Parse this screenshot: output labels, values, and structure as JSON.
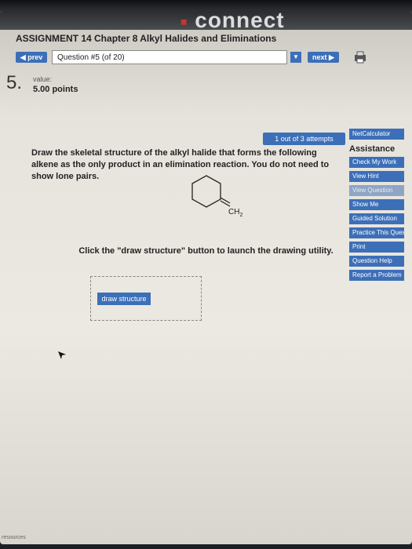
{
  "brand": {
    "name": "connect"
  },
  "assignment": {
    "title": "ASSIGNMENT 14 Chapter 8 Alkyl Halides and Eliminations"
  },
  "nav": {
    "prev_label": "◀ prev",
    "question_select": "Question #5 (of 20)",
    "next_label": "next ▶"
  },
  "question": {
    "number": "5.",
    "value_label": "value:",
    "points": "5.00 points",
    "attempts": "1 out of 3 attempts",
    "prompt": "Draw the skeletal structure of the alkyl halide that forms the following alkene as the only product in an elimination reaction. You do not need to show lone pairs.",
    "molecule_label": "CH",
    "molecule_subscript": "2",
    "instruction": "Click the \"draw structure\" button to launch the drawing utility.",
    "draw_button": "draw structure"
  },
  "sidebar": {
    "calculator": "NetCalculator",
    "assistance_heading": "Assistance",
    "buttons": [
      {
        "label": "Check My Work",
        "enabled": true
      },
      {
        "label": "View Hint",
        "enabled": true
      },
      {
        "label": "View Question",
        "enabled": false
      },
      {
        "label": "Show Me",
        "enabled": true
      },
      {
        "label": "Guided Solution",
        "enabled": true
      },
      {
        "label": "Practice This Question",
        "enabled": true
      },
      {
        "label": "Print",
        "enabled": true
      },
      {
        "label": "Question Help",
        "enabled": true
      },
      {
        "label": "Report a Problem",
        "enabled": true
      }
    ]
  },
  "footer": {
    "resources": "resources"
  },
  "colors": {
    "accent": "#3c6fb8",
    "brand_mark": "#c0392b"
  }
}
